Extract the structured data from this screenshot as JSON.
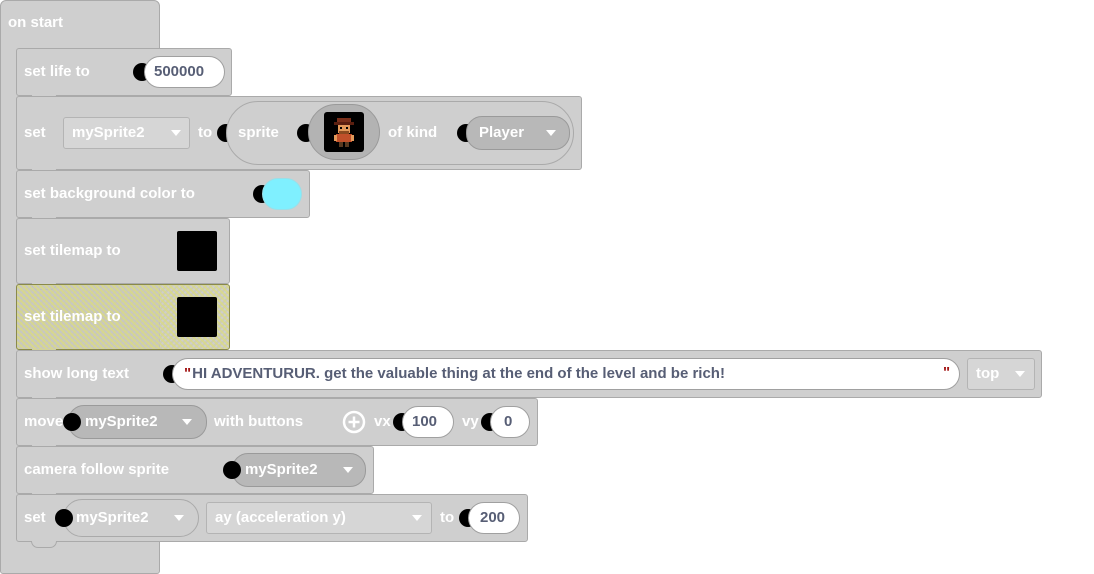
{
  "colors": {
    "block": "#cfcfcf",
    "block_border": "#aaaaaa",
    "selected_block": "#cccc88",
    "background_color_value": "#7ff0ff",
    "text_white": "#ffffff",
    "text_field": "#575e75"
  },
  "hat": {
    "label": "on start"
  },
  "blocks": {
    "set_life": {
      "label": "set life to",
      "value": "500000"
    },
    "set_sprite": {
      "label_set": "set",
      "variable": "mySprite2",
      "label_to": "to",
      "label_sprite": "sprite",
      "label_of_kind": "of kind",
      "kind": "Player",
      "image_icon": "pirate-sprite-icon"
    },
    "set_bg": {
      "label": "set background color to"
    },
    "set_tilemap_1": {
      "label": "set tilemap to"
    },
    "set_tilemap_2": {
      "label": "set tilemap to"
    },
    "show_long_text": {
      "label": "show long text",
      "open_quote": "\"",
      "text": "HI ADVENTURUR.  get the valuable thing at the end of the level and be rich!",
      "close_quote": "\"",
      "position": "top"
    },
    "move": {
      "label_move": "move",
      "sprite": "mySprite2",
      "label_with": "with buttons",
      "plus_icon": "plus-circle-icon",
      "label_vx": "vx",
      "vx": "100",
      "label_vy": "vy",
      "vy": "0"
    },
    "camera": {
      "label": "camera follow sprite",
      "sprite": "mySprite2"
    },
    "set_property": {
      "label_set": "set",
      "sprite": "mySprite2",
      "property": "ay (acceleration y)",
      "label_to": "to",
      "value": "200"
    }
  }
}
